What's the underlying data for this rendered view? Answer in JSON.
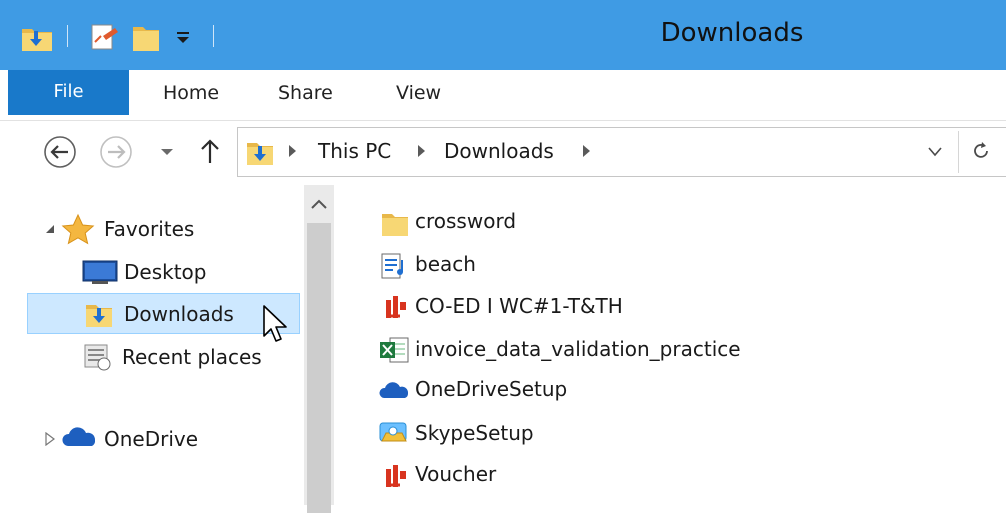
{
  "window": {
    "title": "Downloads"
  },
  "ribbon": {
    "tabs": [
      {
        "label": "File"
      },
      {
        "label": "Home"
      },
      {
        "label": "Share"
      },
      {
        "label": "View"
      }
    ]
  },
  "address": {
    "path": [
      "This PC",
      "Downloads"
    ]
  },
  "nav_pane": {
    "favorites_label": "Favorites",
    "favorites_items": [
      "Desktop",
      "Downloads",
      "Recent places"
    ],
    "onedrive_label": "OneDrive"
  },
  "files": [
    {
      "name": "crossword",
      "icon": "folder-icon"
    },
    {
      "name": "beach",
      "icon": "audio-file-icon"
    },
    {
      "name": "CO-ED I WC#1-T&TH",
      "icon": "pdf-icon"
    },
    {
      "name": "invoice_data_validation_practice",
      "icon": "excel-icon"
    },
    {
      "name": "OneDriveSetup",
      "icon": "onedrive-icon"
    },
    {
      "name": "SkypeSetup",
      "icon": "skype-setup-icon"
    },
    {
      "name": "Voucher",
      "icon": "pdf-icon"
    }
  ],
  "colors": {
    "titlebar": "#3f9be4",
    "file_tab": "#1979ca",
    "selection": "#cde8ff"
  }
}
